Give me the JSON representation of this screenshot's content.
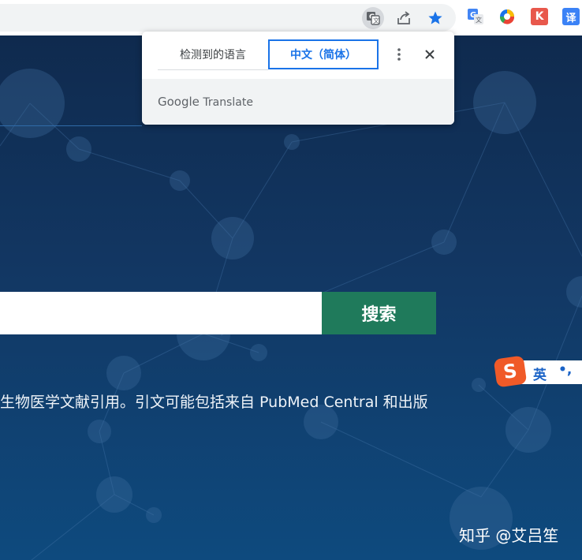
{
  "colors": {
    "hero_top": "#0f2a4e",
    "hero_bottom": "#0e4a7e",
    "search_button": "#1f7a5b",
    "translate_accent": "#1a73e8",
    "bookmark_star": "#1a73e8"
  },
  "toolbar": {
    "icons": [
      "translate-icon",
      "share-icon",
      "bookmark-star-icon"
    ],
    "extensions": [
      "google-translate-extension-icon",
      "colorful-extension-icon",
      "k-extension-icon",
      "translate-yi-extension-icon"
    ],
    "ext_k_label": "K",
    "ext_yi_label": "译"
  },
  "translate_popup": {
    "detected_language_tab": "检测到的语言",
    "target_language_tab": "中文（简体）",
    "more_icon": "more-vert-icon",
    "close_icon": "close-icon",
    "brand_google": "Google",
    "brand_translate": "Translate"
  },
  "search": {
    "input_value": "",
    "button_label": "搜索"
  },
  "description": "生物医学文献引用。引文可能包括来自 PubMed Central 和出版",
  "ime": {
    "logo": "S",
    "mode": "英",
    "punct": "•,"
  },
  "watermark": "知乎 @艾吕笙"
}
